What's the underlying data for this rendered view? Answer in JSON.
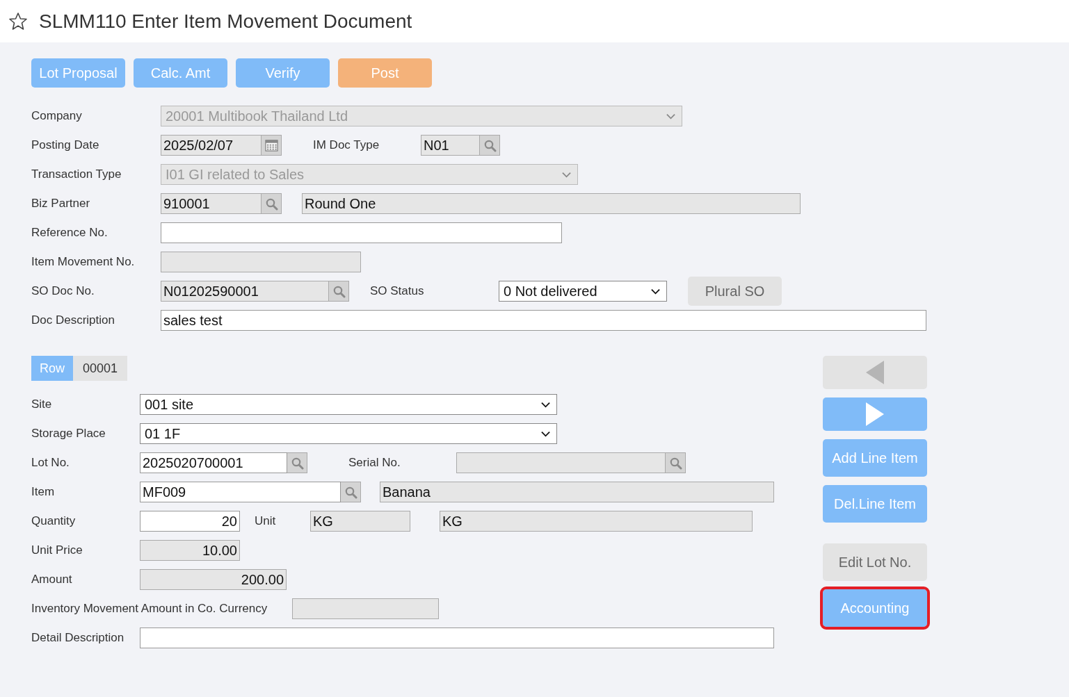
{
  "title": "SLMM110 Enter Item Movement Document",
  "toolbar": [
    {
      "label": "Lot Proposal",
      "kind": "primary"
    },
    {
      "label": "Calc. Amt",
      "kind": "primary"
    },
    {
      "label": "Verify",
      "kind": "primary"
    },
    {
      "label": "Post",
      "kind": "post"
    }
  ],
  "header_form": [
    {
      "label": "Company",
      "fields": [
        {
          "kind": "select",
          "value": "20001 Multibook Thailand Ltd",
          "disabled": true
        }
      ]
    },
    {
      "label": "Posting Date",
      "fields": [
        {
          "kind": "date",
          "value": "2025/02/07",
          "readonly": true
        },
        {
          "kind": "label",
          "text": "IM Doc Type"
        },
        {
          "kind": "lookup",
          "value": "N01",
          "readonly": true
        }
      ]
    },
    {
      "label": "Transaction Type",
      "fields": [
        {
          "kind": "select",
          "value": "I01 GI related to Sales",
          "disabled": true
        }
      ]
    },
    {
      "label": "Biz Partner",
      "fields": [
        {
          "kind": "lookup",
          "value": "910001",
          "readonly": true
        },
        {
          "kind": "input",
          "value": "Round One",
          "readonly": true
        }
      ]
    },
    {
      "label": "Reference No.",
      "fields": [
        {
          "kind": "input",
          "readonly": false
        }
      ]
    },
    {
      "label": "Item Movement No.",
      "fields": [
        {
          "kind": "input",
          "readonly": true
        }
      ]
    },
    {
      "label": "SO Doc No.",
      "fields": [
        {
          "kind": "lookup",
          "value": "N01202590001",
          "readonly": true
        },
        {
          "kind": "label",
          "text": "SO Status"
        },
        {
          "kind": "select",
          "value": "0 Not delivered",
          "disabled": false
        },
        {
          "kind": "button",
          "text": "Plural SO",
          "disabled": true
        }
      ]
    },
    {
      "label": "Doc Description",
      "fields": [
        {
          "kind": "input",
          "value": "sales test",
          "readonly": false
        }
      ]
    }
  ],
  "row_tab": {
    "label": "Row",
    "value": "00001"
  },
  "line_form": [
    {
      "label": "Site",
      "fields": [
        {
          "kind": "select",
          "value": "001 site",
          "disabled": false
        }
      ]
    },
    {
      "label": "Storage Place",
      "fields": [
        {
          "kind": "select",
          "value": "01 1F",
          "disabled": false
        }
      ]
    },
    {
      "label": "Lot No.",
      "fields": [
        {
          "kind": "lookup",
          "value": "2025020700001",
          "readonly": false
        },
        {
          "kind": "label",
          "text": "Serial No."
        },
        {
          "kind": "lookup",
          "readonly": true
        }
      ]
    },
    {
      "label": "Item",
      "fields": [
        {
          "kind": "lookup",
          "value": "MF009",
          "readonly": false
        },
        {
          "kind": "input",
          "value": "Banana",
          "readonly": true
        }
      ]
    },
    {
      "label": "Quantity",
      "fields": [
        {
          "kind": "number",
          "value": "20",
          "readonly": false
        },
        {
          "kind": "label",
          "text": "Unit"
        },
        {
          "kind": "input",
          "value": "KG",
          "readonly": true
        },
        {
          "kind": "input",
          "value": "KG",
          "readonly": true
        }
      ]
    },
    {
      "label": "Unit Price",
      "fields": [
        {
          "kind": "number",
          "value": "10.00",
          "readonly": true
        }
      ]
    },
    {
      "label": "Amount",
      "fields": [
        {
          "kind": "number",
          "value": "200.00",
          "readonly": true
        }
      ]
    },
    {
      "label": "Inventory Movement Amount in Co. Currency",
      "fields": [
        {
          "kind": "input",
          "readonly": true
        }
      ]
    },
    {
      "label": "Detail Description",
      "fields": [
        {
          "kind": "input",
          "readonly": false
        }
      ]
    }
  ],
  "side_buttons": [
    {
      "kind": "prev",
      "disabled": true,
      "highlighted": false
    },
    {
      "kind": "next",
      "disabled": false,
      "highlighted": false
    },
    {
      "kind": "text",
      "label": "Add Line Item",
      "disabled": false,
      "highlighted": false
    },
    {
      "kind": "text",
      "label": "Del.Line Item",
      "disabled": false,
      "highlighted": false
    },
    {
      "kind": "text",
      "label": "Edit Lot No.",
      "disabled": true,
      "highlighted": false
    },
    {
      "kind": "text",
      "label": "Accounting",
      "disabled": false,
      "highlighted": true
    }
  ]
}
